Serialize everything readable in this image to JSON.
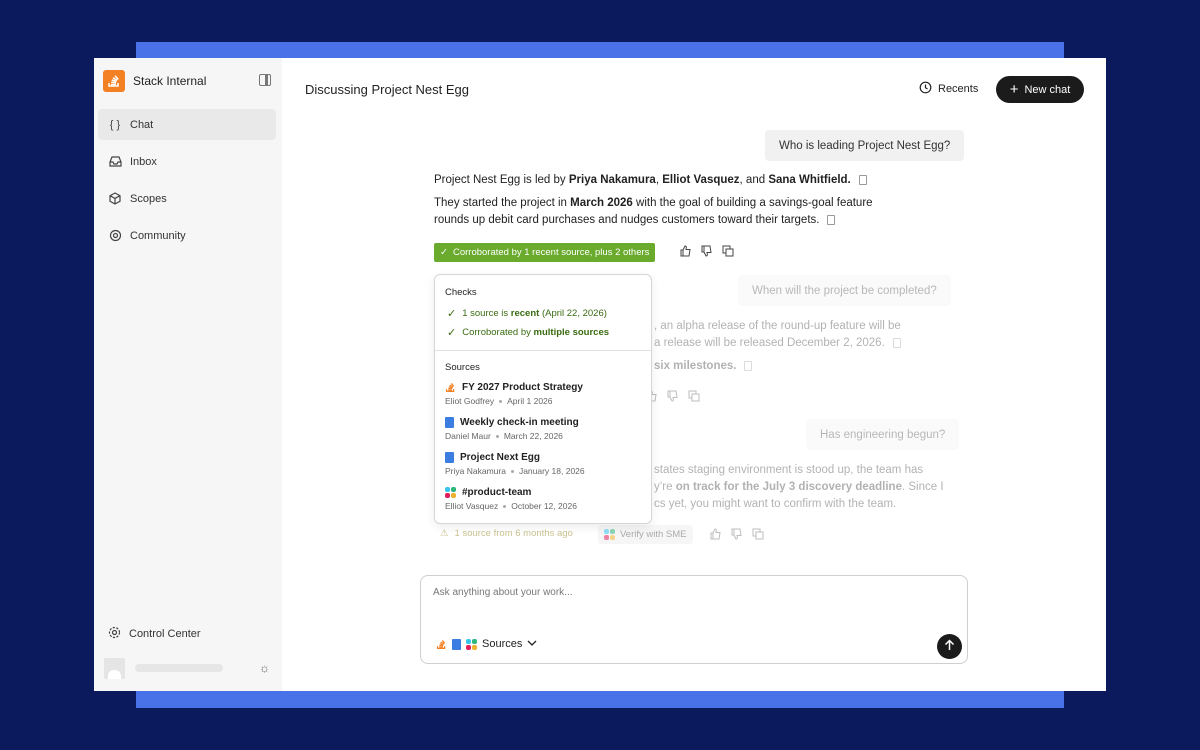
{
  "app": {
    "name": "Stack Internal"
  },
  "sidebar": {
    "items": [
      {
        "label": "Chat",
        "icon": "braces-icon",
        "active": true
      },
      {
        "label": "Inbox",
        "icon": "inbox-icon",
        "active": false
      },
      {
        "label": "Scopes",
        "icon": "cube-icon",
        "active": false
      },
      {
        "label": "Community",
        "icon": "community-icon",
        "active": false
      }
    ],
    "control_center": "Control Center"
  },
  "header": {
    "title": "Discussing Project Nest Egg",
    "recents": "Recents",
    "new_chat": "New chat"
  },
  "conversation": {
    "q1": "Who is leading Project Nest Egg?",
    "a1_p1": {
      "pre": "Project Nest Egg is led by ",
      "n1": "Priya Nakamura",
      "s1": ", ",
      "n2": "Elliot Vasquez",
      "s2": ", and ",
      "n3": "Sana Whitfield."
    },
    "a1_p2": {
      "pre": "They started the project in ",
      "date": "March 2026",
      "l1_rest": " with the goal of building a savings-goal feature",
      "l2": "rounds up debit card purchases and nudges customers toward their targets."
    },
    "badge": "Corroborated by 1 recent source, plus 2 others",
    "q2": "When will the project be completed?",
    "a2_l1": ", an alpha release of the round-up feature will be",
    "a2_l2": "a release will be released December 2, 2026.",
    "a2_l3": "six milestones.",
    "q3": "Has engineering begun?",
    "a3_l1": "states staging environment is stood up, the team has",
    "a3_l2_pre": "y’re ",
    "a3_l2_bold": "on track for the July 3 discovery deadline",
    "a3_l2_post": ". Since I",
    "a3_l3": "cs yet, you might want to confirm with the team.",
    "warn": "1 source from 6 months ago",
    "verify": "Verify with SME"
  },
  "popover": {
    "checks_title": "Checks",
    "check1": {
      "pre": "1 source is ",
      "bold": "recent",
      "post": " (April 22, 2026)"
    },
    "check2": {
      "pre": "Corroborated by ",
      "bold": "multiple sources"
    },
    "sources_title": "Sources",
    "sources": [
      {
        "title": "FY 2027 Product Strategy",
        "author": "Eliot Godfrey",
        "date": "April 1 2026",
        "icon": "stackoverflow-icon"
      },
      {
        "title": "Weekly check-in meeting",
        "author": "Daniel Maur",
        "date": "March 22, 2026",
        "icon": "doc-icon"
      },
      {
        "title": "Project Next Egg",
        "author": "Priya Nakamura",
        "date": "January 18, 2026",
        "icon": "doc-icon"
      },
      {
        "title": "#product-team",
        "author": "Elliot Vasquez",
        "date": "October 12, 2026",
        "icon": "slack-icon"
      }
    ]
  },
  "composer": {
    "placeholder": "Ask anything about your work...",
    "sources_label": "Sources"
  },
  "colors": {
    "accent_green": "#6aaa2c",
    "brand_orange": "#f48024",
    "background": "#0a1a5c",
    "band": "#4a72e8"
  }
}
